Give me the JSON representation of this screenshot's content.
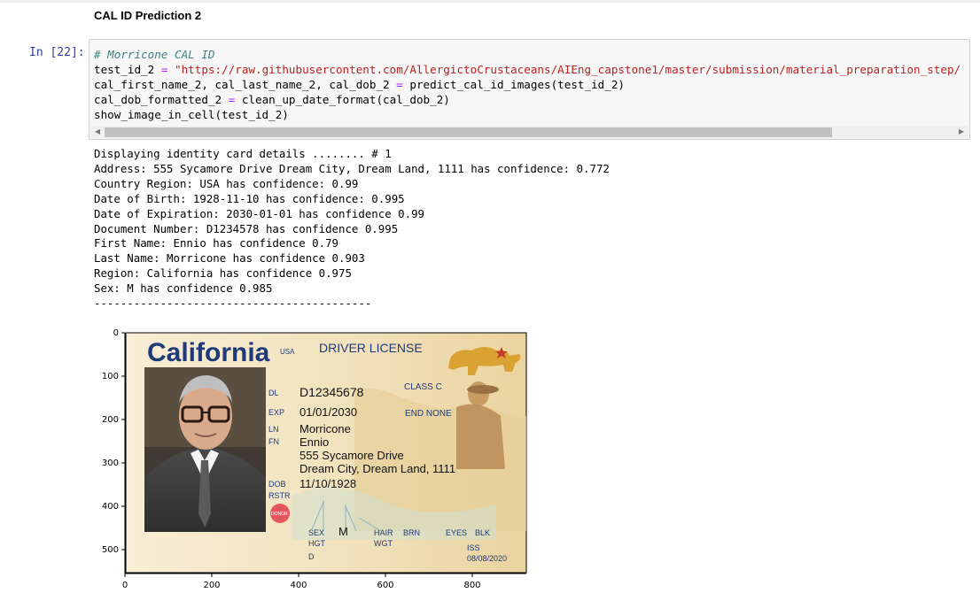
{
  "notebook": {
    "heading": "CAL ID Prediction 2",
    "prompt": "In [22]:",
    "code": {
      "line1_comment": "# Morricone CAL ID",
      "line2_var": "test_id_2 ",
      "line2_op": "=",
      "line2_string": " \"https://raw.githubusercontent.com/AllergictoCrustaceans/AIEng_capstone1/master/submission/material_preparation_step/",
      "line3_left": "cal_first_name_2, cal_last_name_2, cal_dob_2 ",
      "line3_op": "=",
      "line3_right": " predict_cal_id_images(test_id_2)",
      "line4_left": "cal_dob_formatted_2 ",
      "line4_op": "=",
      "line4_right": " clean_up_date_format(cal_dob_2)",
      "line5": "show_image_in_cell(test_id_2)"
    },
    "output_lines": [
      "Displaying identity card details ........ # 1",
      "Address: 555 Sycamore Drive Dream City, Dream Land, 1111 has confidence: 0.772",
      "Country Region: USA has confidence: 0.99",
      "Date of Birth: 1928-11-10 has confidence: 0.995",
      "Date of Expiration: 2030-01-01 has confidence 0.99",
      "Document Number: D1234578 has confidence 0.995",
      "First Name: Ennio has confidence 0.79",
      "Last Name: Morricone has confidence 0.903",
      "Region: California has confidence 0.975",
      "Sex: M has confidence 0.985",
      "------------------------------------------"
    ]
  },
  "plot": {
    "y_ticks": [
      "0",
      "100",
      "200",
      "300",
      "400",
      "500"
    ],
    "x_ticks": [
      "0",
      "200",
      "400",
      "600",
      "800"
    ]
  },
  "card": {
    "state": "California",
    "usa": "USA",
    "title": "DRIVER LICENSE",
    "class_label": "CLASS C",
    "dl_label": "DL",
    "dl_value": "D12345678",
    "exp_label": "EXP",
    "exp_value": "01/01/2030",
    "end_label": "END NONE",
    "ln_label": "LN",
    "ln_value": "Morricone",
    "fn_label": "FN",
    "fn_value": "Ennio",
    "addr1": "555 Sycamore Drive",
    "addr2": "Dream City, Dream Land, 1111",
    "dob_label": "DOB",
    "dob_value": "11/10/1928",
    "rstr_label": "RSTR",
    "donor": "DONOR",
    "sex_label": "SEX",
    "sex_value": "M",
    "hair_label": "HAIR",
    "hair_value": "BRN",
    "eyes_label": "EYES",
    "eyes_value": "BLK",
    "hgt_label": "HGT",
    "wgt_label": "WGT",
    "d_label": "D",
    "iss_label": "ISS",
    "iss_value": "08/08/2020"
  },
  "colors": {
    "prompt": "#303f9f",
    "card_title": "#1f3a7a",
    "card_bg": "#f3e6c6",
    "bear": "#d9a233"
  }
}
